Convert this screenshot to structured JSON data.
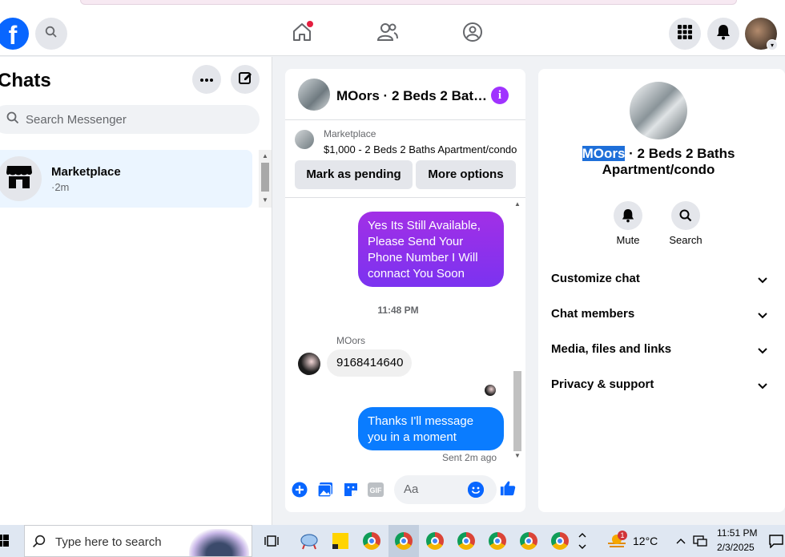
{
  "topnav": {
    "logo": "f",
    "icons": [
      "search-icon",
      "home-icon",
      "friends-icon",
      "groups-icon",
      "menu-grid-icon",
      "bell-icon",
      "profile-avatar"
    ]
  },
  "left": {
    "title": "Chats",
    "search_placeholder": "Search Messenger",
    "chats": [
      {
        "name": "Marketplace",
        "time": "·2m"
      }
    ]
  },
  "chat": {
    "title": "MOors · 2 Beds 2 Bat…",
    "marketplace_label": "Marketplace",
    "listing": "$1,000 - 2 Beds 2 Baths Apartment/condo",
    "btn_pending": "Mark as pending",
    "btn_more": "More options",
    "messages": {
      "first": "Yes Its Still Available, Please Send Your Phone Number I Will connact You Soon",
      "timestamp": "11:48 PM",
      "sender": "MOors",
      "received": "9168414640",
      "last": "Thanks I'll message you in a moment",
      "status": "Sent 2m ago"
    },
    "composer_placeholder": "Aa",
    "accent": "#0a7cff"
  },
  "info": {
    "name_highlight": "MOors",
    "name_rest": " · 2 Beds 2 Baths Apartment/condo",
    "actions": [
      "Mute",
      "Search"
    ],
    "sections": [
      "Customize chat",
      "Chat members",
      "Media, files and links",
      "Privacy & support"
    ]
  },
  "taskbar": {
    "search_placeholder": "Type here to search",
    "weather": "12°C",
    "weather_badge": "1",
    "time": "11:51 PM",
    "date": "2/3/2025"
  }
}
